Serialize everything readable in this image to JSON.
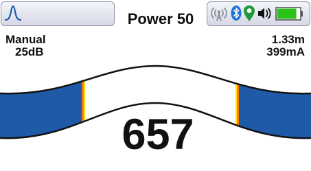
{
  "toolbar": {
    "signal_mode_icon": "peak-response-icon",
    "status_icons": [
      "antenna-signal-icon",
      "bluetooth-icon",
      "gps-pin-icon",
      "speaker-volume-icon",
      "battery-icon"
    ],
    "battery_level": 0.85
  },
  "header": {
    "title": "Power 50"
  },
  "info": {
    "mode": "Manual",
    "gain": "25dB",
    "depth": "1.33m",
    "current": "399mA"
  },
  "display": {
    "signal_strength": "657"
  },
  "colors": {
    "accent_blue": "#1f5aa8",
    "bluetooth_blue": "#1e73d8",
    "gps_green": "#1f9a3a",
    "battery_green": "#2bc219",
    "marker_orange": "#ff7a10",
    "marker_yellow": "#ffe400"
  }
}
